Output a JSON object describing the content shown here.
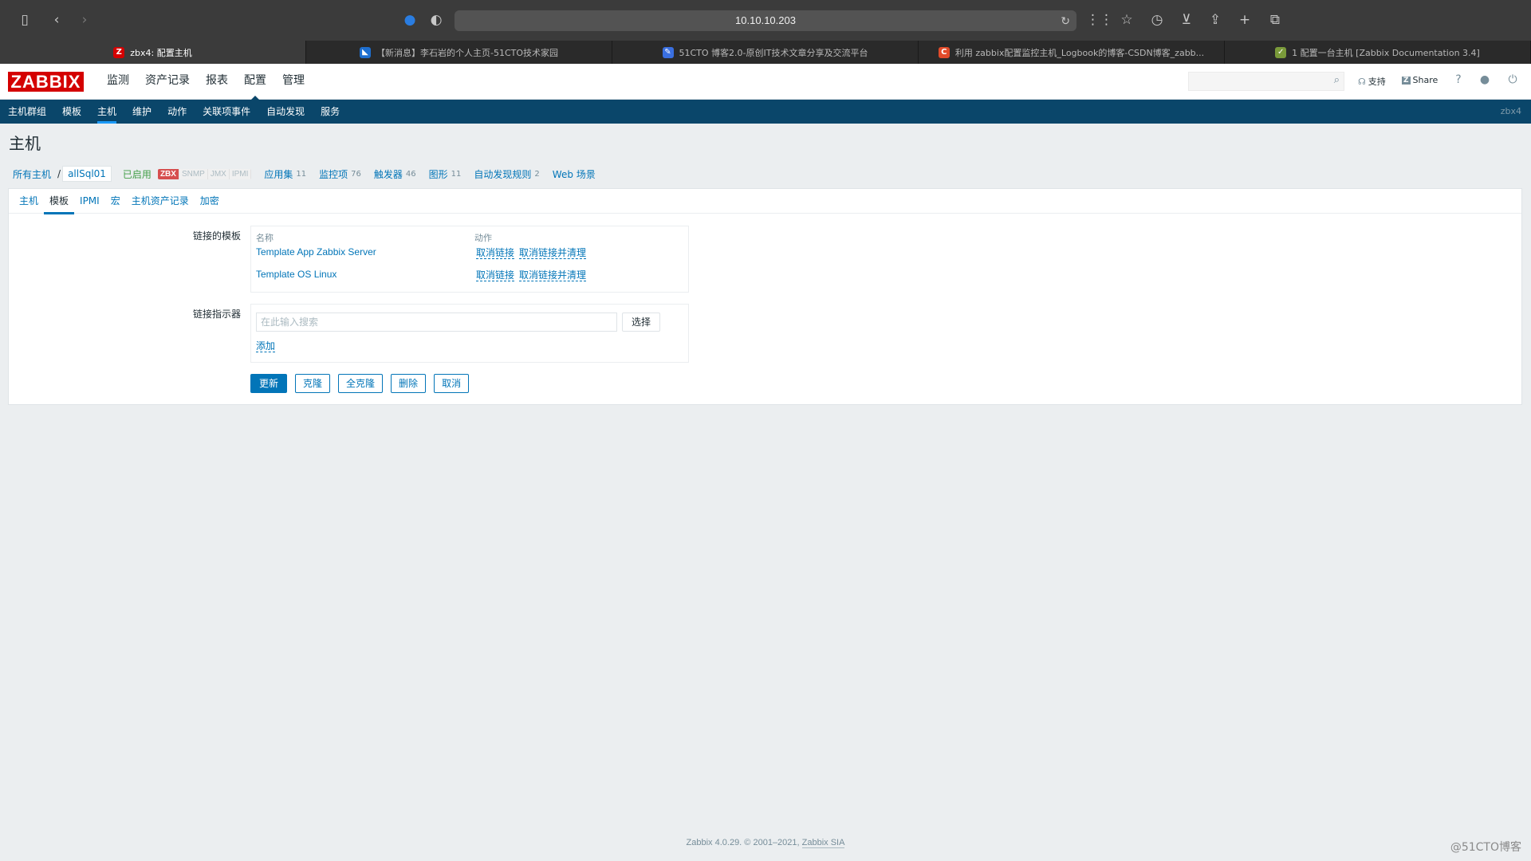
{
  "browser": {
    "url": "10.10.10.203",
    "tabs": [
      {
        "label": "zbx4: 配置主机",
        "favicon": "Z",
        "favicon_color": "#d40000",
        "active": true
      },
      {
        "label": "【新消息】李石岩的个人主页-51CTO技术家园",
        "favicon": "◣",
        "favicon_color": "#1e6fd0",
        "active": false
      },
      {
        "label": "51CTO 博客2.0-原创IT技术文章分享及交流平台",
        "favicon": "✎",
        "favicon_color": "#3a6fe0",
        "active": false
      },
      {
        "label": "利用 zabbix配置监控主机_Logbook的博客-CSDN博客_zabb...",
        "favicon": "C",
        "favicon_color": "#e24b2a",
        "active": false
      },
      {
        "label": "1 配置一台主机 [Zabbix Documentation 3.4]",
        "favicon": "✓",
        "favicon_color": "#7a9a3a",
        "active": false
      }
    ]
  },
  "header": {
    "logo": "ZABBIX",
    "menu": [
      "监测",
      "资产记录",
      "报表",
      "配置",
      "管理"
    ],
    "selected_menu": "配置",
    "support_label": "支持",
    "share_label": "Share",
    "help_label": "?"
  },
  "submenu": {
    "items": [
      "主机群组",
      "模板",
      "主机",
      "维护",
      "动作",
      "关联项事件",
      "自动发现",
      "服务"
    ],
    "selected": "主机",
    "server_name": "zbx4"
  },
  "page": {
    "title": "主机",
    "breadcrumb": {
      "all_hosts": "所有主机",
      "separator": "/",
      "current": "allSql01",
      "status": "已启用",
      "availability": [
        "ZBX",
        "SNMP",
        "JMX",
        "IPMI"
      ],
      "links": [
        {
          "label": "应用集",
          "count": "11"
        },
        {
          "label": "监控项",
          "count": "76"
        },
        {
          "label": "触发器",
          "count": "46"
        },
        {
          "label": "图形",
          "count": "11"
        },
        {
          "label": "自动发现规则",
          "count": "2"
        }
      ],
      "web_label": "Web 场景"
    },
    "tabs": [
      "主机",
      "模板",
      "IPMI",
      "宏",
      "主机资产记录",
      "加密"
    ],
    "active_tab": "模板",
    "linked_templates": {
      "label": "链接的模板",
      "col_name": "名称",
      "col_action": "动作",
      "rows": [
        {
          "name": "Template App Zabbix Server",
          "unlink": "取消链接",
          "unlink_clear": "取消链接并清理"
        },
        {
          "name": "Template OS Linux",
          "unlink": "取消链接",
          "unlink_clear": "取消链接并清理"
        }
      ]
    },
    "link_indicator": {
      "label": "链接指示器",
      "placeholder": "在此输入搜索",
      "select_button": "选择",
      "add_link": "添加"
    },
    "buttons": {
      "update": "更新",
      "clone": "克隆",
      "full_clone": "全克隆",
      "delete": "删除",
      "cancel": "取消"
    }
  },
  "footer": {
    "text": "Zabbix 4.0.29. © 2001–2021, ",
    "link": "Zabbix SIA"
  },
  "watermark": "@51CTO博客"
}
